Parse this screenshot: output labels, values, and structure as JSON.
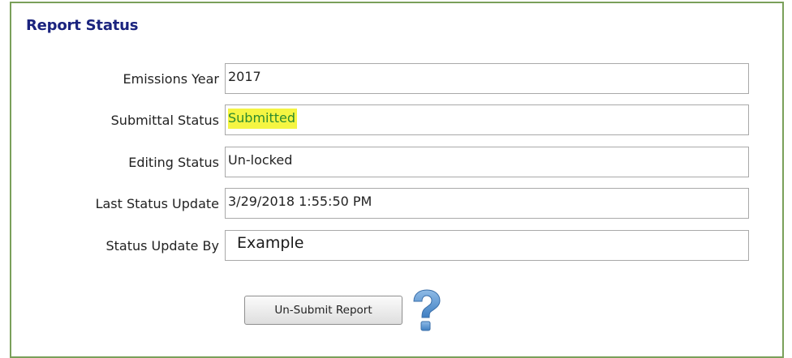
{
  "panel": {
    "title": "Report Status"
  },
  "fields": [
    {
      "label": "Emissions Year",
      "value": "2017"
    },
    {
      "label": "Submittal Status",
      "value": "Submitted"
    },
    {
      "label": "Editing Status",
      "value": "Un-locked"
    },
    {
      "label": "Last Status Update",
      "value": "3/29/2018 1:55:50 PM"
    },
    {
      "label": "Status Update By",
      "value": "Example"
    }
  ],
  "actions": {
    "unsubmit_label": "Un-Submit Report",
    "help_icon": "question-mark-icon"
  },
  "colors": {
    "panel_border": "#7aa05a",
    "title": "#1a237e",
    "highlight": "#f5f542",
    "submitted_text": "#2e8b2e",
    "help_icon": "#5b95cf"
  }
}
